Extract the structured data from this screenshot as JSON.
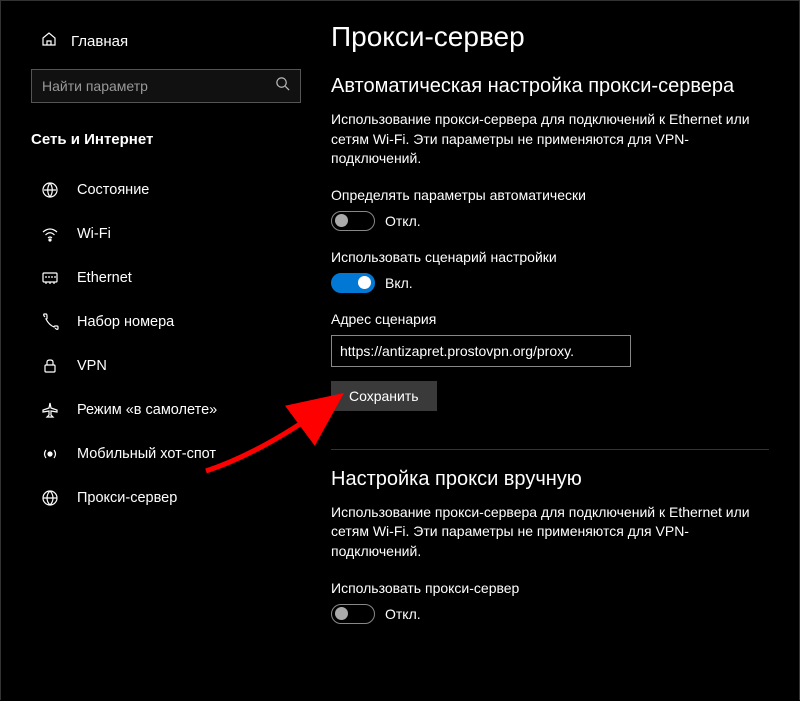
{
  "sidebar": {
    "home_label": "Главная",
    "search_placeholder": "Найти параметр",
    "category": "Сеть и Интернет",
    "items": [
      {
        "label": "Состояние",
        "icon": "status-icon"
      },
      {
        "label": "Wi-Fi",
        "icon": "wifi-icon"
      },
      {
        "label": "Ethernet",
        "icon": "ethernet-icon"
      },
      {
        "label": "Набор номера",
        "icon": "dialup-icon"
      },
      {
        "label": "VPN",
        "icon": "vpn-icon"
      },
      {
        "label": "Режим «в самолете»",
        "icon": "airplane-icon"
      },
      {
        "label": "Мобильный хот-спот",
        "icon": "hotspot-icon"
      },
      {
        "label": "Прокси-сервер",
        "icon": "proxy-icon"
      }
    ]
  },
  "main": {
    "title": "Прокси-сервер",
    "auto_section": {
      "title": "Автоматическая настройка прокси-сервера",
      "description": "Использование прокси-сервера для подключений к Ethernet или сетям Wi-Fi. Эти параметры не применяются для VPN-подключений.",
      "detect_label": "Определять параметры автоматически",
      "detect_state": "Откл.",
      "script_label": "Использовать сценарий настройки",
      "script_state": "Вкл.",
      "address_label": "Адрес сценария",
      "address_value": "https://antizapret.prostovpn.org/proxy.",
      "save_label": "Сохранить"
    },
    "manual_section": {
      "title": "Настройка прокси вручную",
      "description": "Использование прокси-сервера для подключений к Ethernet или сетям Wi-Fi. Эти параметры не применяются для VPN-подключений.",
      "use_label": "Использовать прокси-сервер",
      "use_state": "Откл."
    }
  }
}
